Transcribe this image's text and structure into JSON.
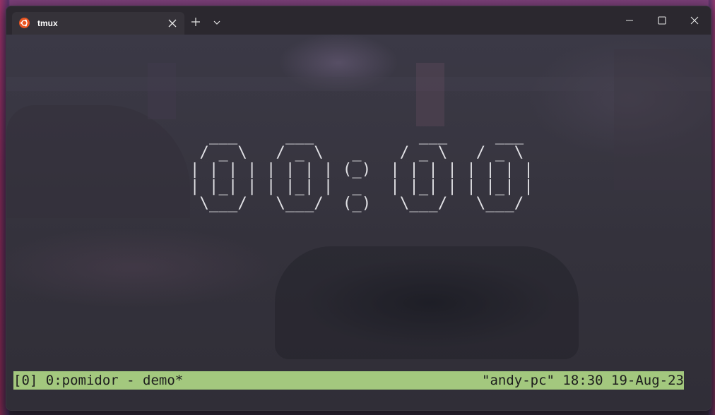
{
  "tab": {
    "title": "tmux",
    "icon": "ubuntu-icon"
  },
  "window_controls": {
    "new_tab": "plus-icon",
    "dropdown": "chevron-down-icon",
    "minimize": "minimize-icon",
    "maximize": "maximize-icon",
    "close": "close-icon"
  },
  "terminal": {
    "clock_text": "  ___     ___           ___     ___\n / _ \\   / _ \\   _    / _ \\   / _ \\\n| | | | | | | | (_)  | | | | | | | |\n| |_| | | |_| |  _   | |_| | | |_| |\n \\___/   \\___/  (_)   \\___/   \\___/",
    "clock_value": "00:00"
  },
  "status_bar": {
    "left": "[0] 0:pomidor - demo*",
    "right": "\"andy-pc\" 18:30 19-Aug-23",
    "background_color": "#a3c87e"
  },
  "colors": {
    "ubuntu_orange": "#e95420",
    "terminal_text": "#e2e2e6",
    "titlebar": "#2b282f"
  }
}
